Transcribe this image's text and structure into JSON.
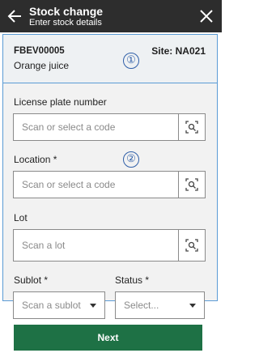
{
  "header": {
    "title": "Stock change",
    "subtitle": "Enter stock details",
    "back_icon": "arrow-left-icon",
    "close_icon": "close-icon"
  },
  "summary": {
    "product_code": "FBEV00005",
    "product_name": "Orange juice",
    "site": "Site: NA021",
    "marker": "①"
  },
  "form": {
    "marker": "②",
    "license_plate": {
      "label": "License plate number",
      "placeholder": "Scan or select a code"
    },
    "location": {
      "label": "Location *",
      "placeholder": "Scan or select a code"
    },
    "lot": {
      "label": "Lot",
      "placeholder": "Scan a lot"
    },
    "sublot": {
      "label": "Sublot *",
      "placeholder": "Scan a sublot"
    },
    "status": {
      "label": "Status *",
      "placeholder": "Select..."
    }
  },
  "footer": {
    "next_label": "Next"
  },
  "colors": {
    "header_bg": "#2d2d2d",
    "accent_border": "#5b9bd5",
    "primary": "#1e7145"
  }
}
